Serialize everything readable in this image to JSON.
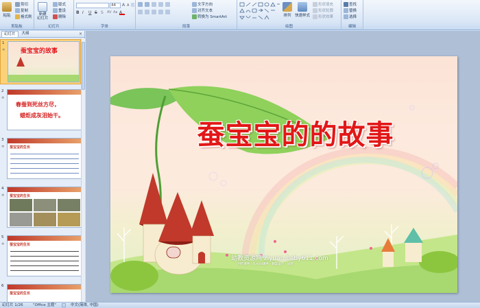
{
  "ribbon": {
    "clipboard": {
      "paste": "粘贴",
      "cut": "剪切",
      "copy": "复制",
      "format_painter": "格式刷",
      "label": "剪贴板"
    },
    "slides": {
      "new_slide": "新建\n幻灯片",
      "layout": "版式",
      "reset": "重设",
      "delete": "删除",
      "label": "幻灯片"
    },
    "font": {
      "font_name": "",
      "font_size": "44",
      "label": "字体"
    },
    "paragraph": {
      "text_direction": "文字方向",
      "align_text": "对齐文本",
      "convert_smartart": "转换为 SmartArt",
      "label": "段落"
    },
    "drawing": {
      "arrange": "排列",
      "quick_styles": "快速样式",
      "shape_fill": "形状填充",
      "shape_outline": "形状轮廓",
      "shape_effects": "形状效果",
      "label": "绘图"
    },
    "editing": {
      "find": "查找",
      "replace": "替换",
      "select": "选择",
      "label": "编辑"
    }
  },
  "panel": {
    "tab_slides": "幻灯片",
    "tab_outline": "大纲",
    "close": "×",
    "thumbs": [
      {
        "num": "1",
        "text": "蚕宝宝的故事"
      },
      {
        "num": "2",
        "text_line1": "春蚕到死丝方尽，",
        "text_line2": "蜡炬成灰泪始干。"
      },
      {
        "num": "3",
        "heading": "蚕宝宝的生长"
      },
      {
        "num": "4",
        "heading": "蚕宝宝的生长"
      },
      {
        "num": "5",
        "heading": "蚕宝宝的生长"
      },
      {
        "num": "6",
        "heading": "蚕宝宝的生长"
      }
    ]
  },
  "slide": {
    "title": "蚕宝宝的的故事",
    "watermark": "幼教资源网 ziyuan.baby611.com",
    "watermark_sub": "PPT课件 · FLASH课件 · 教案设计 · 试卷"
  },
  "status": {
    "slide_counter": "幻灯片 1/26",
    "theme": "\"Office 主题\"",
    "language": "中文(简体, 中国)"
  },
  "colors": {
    "title_red": "#e21717",
    "accent_orange": "#e3a43a",
    "ribbon_blue": "#dbe7f6"
  }
}
